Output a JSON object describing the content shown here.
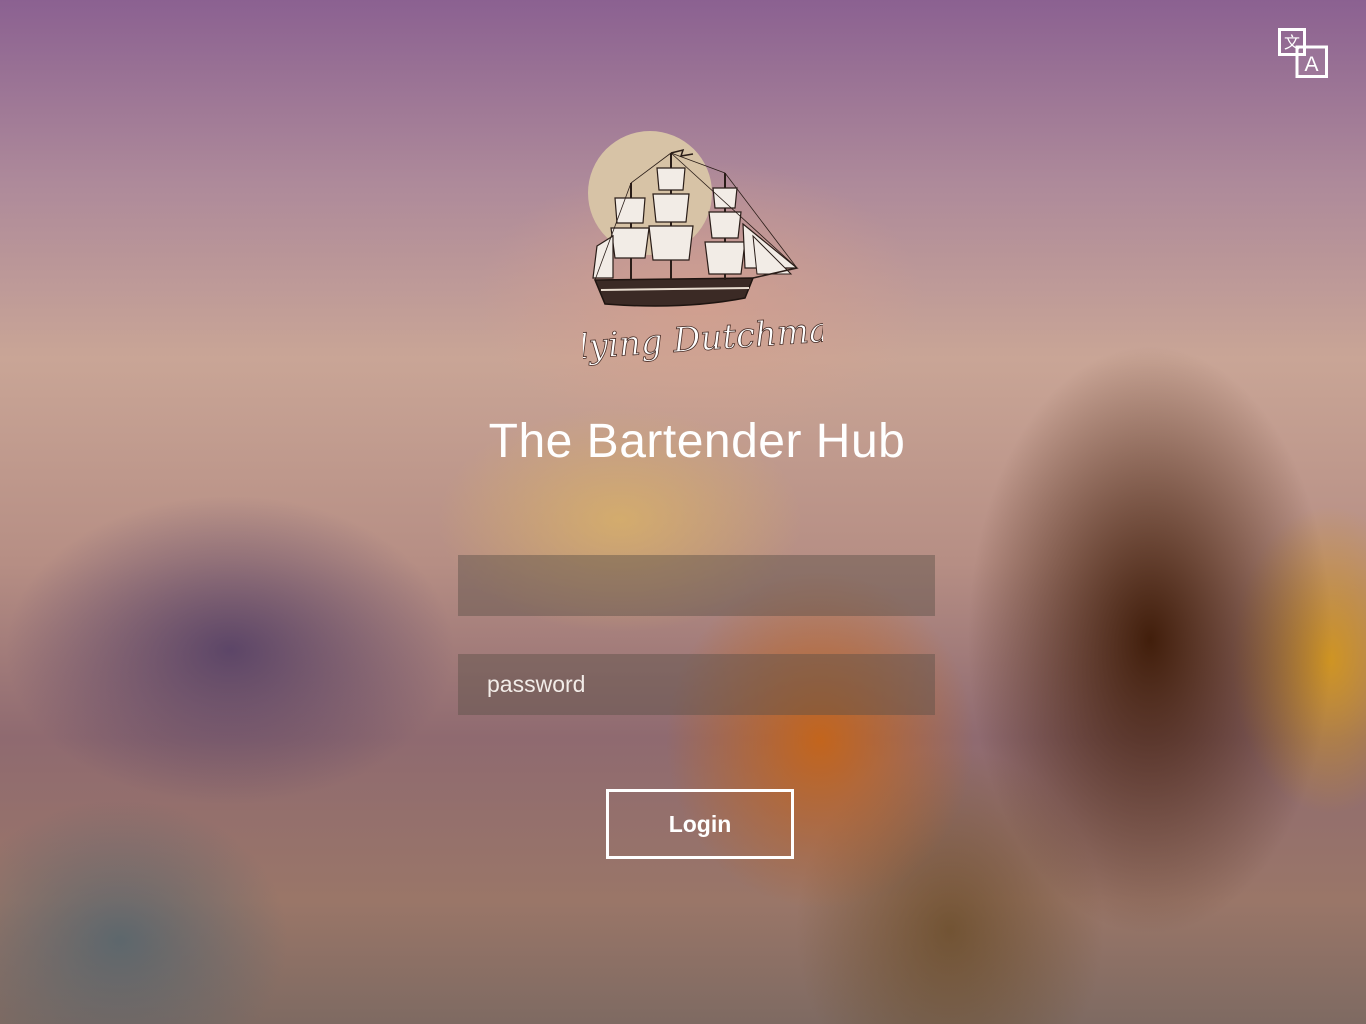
{
  "app": {
    "title": "The Bartender Hub",
    "brand_name": "Flying Dutchman"
  },
  "header": {
    "language_icon": "translate-icon"
  },
  "form": {
    "username_placeholder": "",
    "password_placeholder": "password",
    "login_label": "Login"
  },
  "colors": {
    "text": "#ffffff",
    "field_bg": "rgba(90,80,70,0.45)",
    "logo_moon": "#d7c3a6"
  }
}
